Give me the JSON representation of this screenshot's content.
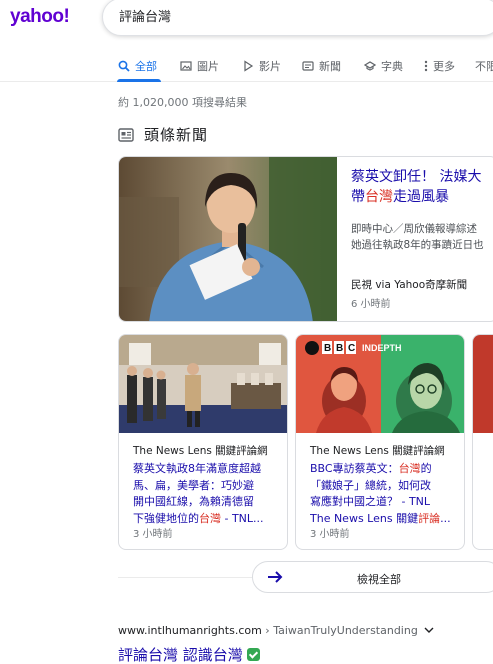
{
  "logo": {
    "text": "yahoo!"
  },
  "search": {
    "value": "評論台灣"
  },
  "tabs": [
    {
      "label": "全部",
      "icon": "search-icon",
      "active": true
    },
    {
      "label": "圖片",
      "icon": "image-icon"
    },
    {
      "label": "影片",
      "icon": "play-icon"
    },
    {
      "label": "新聞",
      "icon": "news-icon"
    },
    {
      "label": "字典",
      "icon": "book-icon"
    },
    {
      "label": "更多",
      "icon": "more-vert-icon"
    },
    {
      "label": "不限"
    }
  ],
  "result_stats": "約 1,020,000 項搜尋結果",
  "top_stories": {
    "title": "頭條新聞",
    "featured": {
      "headline_line1": "蔡英文卸任！ 法媒大",
      "headline_line2_pre": "帶",
      "headline_line2_hl": "台灣",
      "headline_line2_post": "走過風暴",
      "snippet_line1": "即時中心／周欣儀報導綜述",
      "snippet_line2": "她過往執政8年的事蹟近日也",
      "source": "民視 via Yahoo奇摩新聞",
      "time": "6 小時前"
    },
    "cards": [
      {
        "source": "The News Lens 關鍵評論網",
        "line1": "蔡英文執政8年滿意度超越",
        "line2": "馬、扁，美學者：巧妙避",
        "line3": "開中國紅線，為賴清德留",
        "line4_pre": "下強健地位的",
        "line4_hl": "台灣",
        "line4_post": " - TNL...",
        "time": "3 小時前"
      },
      {
        "source": "The News Lens 關鍵評論網",
        "line1_pre": "BBC專訪蔡英文：",
        "line1_hl": "台灣",
        "line1_post": "的",
        "line2": "「鐵娘子」總統，如何改",
        "line3": "寫應對中國之道？ - TNL",
        "line4_pre": "The News Lens 關鍵",
        "line4_hl": "評論",
        "line4_post": "...",
        "time": "3 小時前",
        "badge": "INDEPTH",
        "badge_brand": "BBC"
      }
    ],
    "view_all": "檢視全部"
  },
  "result": {
    "domain": "www.intlhumanrights.com",
    "crumb": " › TaiwanTrulyUnderstanding",
    "title_hl": "評論台灣",
    "title_rest": " 認識台灣"
  },
  "colors": {
    "brand": "#6001d2",
    "link": "#1a0dab",
    "accent": "#1a73e8",
    "highlight": "#d93025"
  }
}
